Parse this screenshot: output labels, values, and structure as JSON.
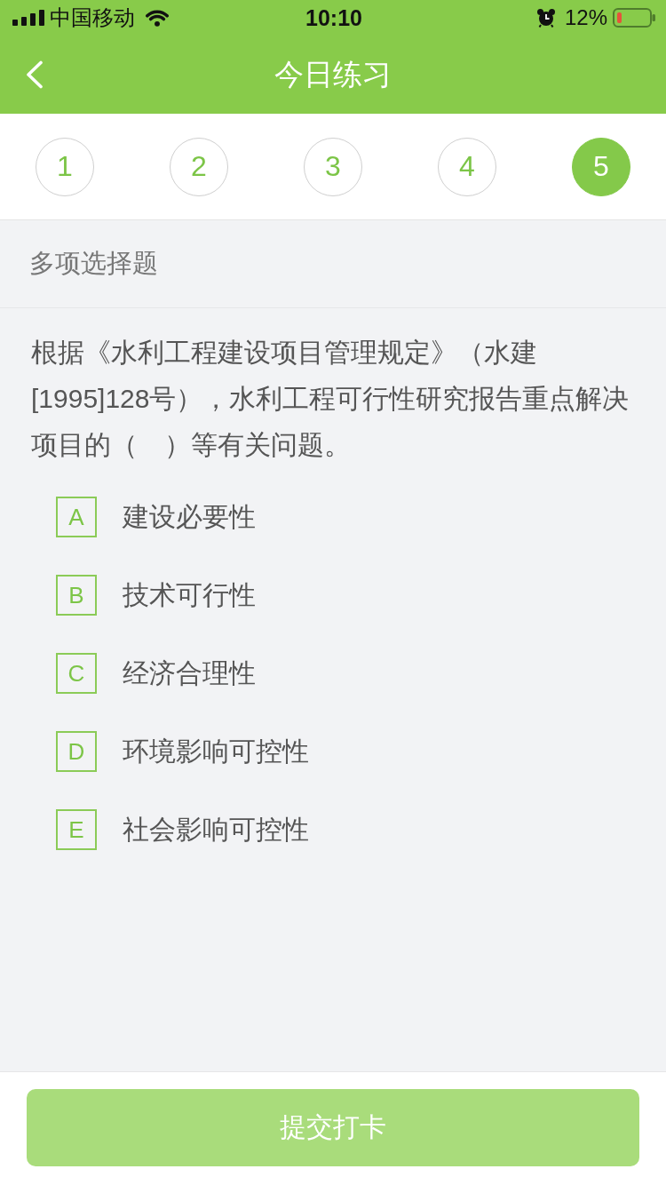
{
  "status_bar": {
    "carrier": "中国移动",
    "time": "10:10",
    "battery": "12%"
  },
  "nav_bar": {
    "title": "今日练习"
  },
  "question_tabs": [
    {
      "label": "1",
      "selected": false
    },
    {
      "label": "2",
      "selected": false
    },
    {
      "label": "3",
      "selected": false
    },
    {
      "label": "4",
      "selected": false
    },
    {
      "label": "5",
      "selected": true
    }
  ],
  "question": {
    "type_label": "多项选择题",
    "text": "根据《水利工程建设项目管理规定》（水建[1995]128号），水利工程可行性研究报告重点解决项目的（　）等有关问题。",
    "options": [
      {
        "letter": "A",
        "text": "建设必要性",
        "selected": false
      },
      {
        "letter": "B",
        "text": "技术可行性",
        "selected": false
      },
      {
        "letter": "C",
        "text": "经济合理性",
        "selected": false
      },
      {
        "letter": "D",
        "text": "环境影响可控性",
        "selected": false
      },
      {
        "letter": "E",
        "text": "社会影响可控性",
        "selected": false
      }
    ]
  },
  "submit_button": {
    "label": "提交打卡",
    "disabled": true
  }
}
